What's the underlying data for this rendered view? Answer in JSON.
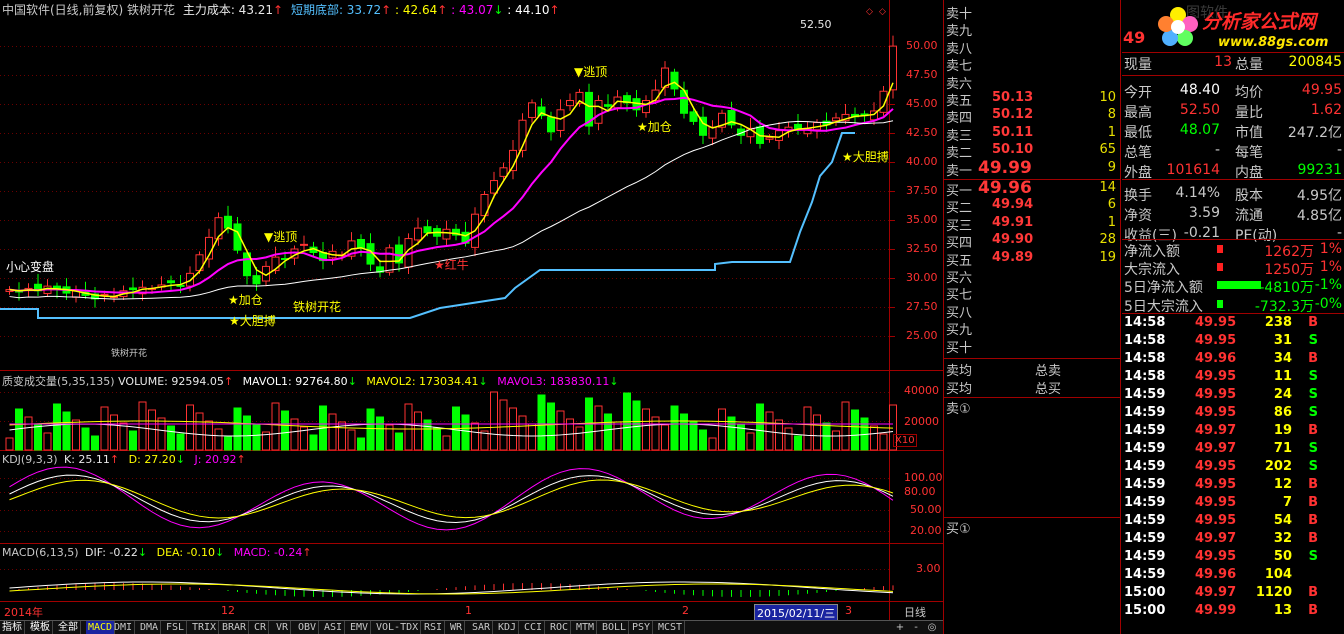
{
  "header": {
    "title": "中国软件(日线,前复权) 铁树开花",
    "cost_label": "主力成本: 43.21",
    "short_bottom_label": "短期底部: 33.72",
    "v2": ": 42.64",
    "v3": ": 43.07",
    "v4": ": 44.10"
  },
  "price_axis": [
    "50.00",
    "47.50",
    "45.00",
    "42.50",
    "40.00",
    "37.50",
    "35.00",
    "32.50",
    "30.00",
    "27.50",
    "25.00"
  ],
  "price_notes": {
    "high_marker": "52.50",
    "warn": "小心变盘",
    "escape_top_1": "▼逃顶",
    "escape_top_2": "▼逃顶",
    "add_1": "★加仓",
    "add_2": "★加仓",
    "bold_1": "★大胆搏",
    "bold_2": "★大胆搏",
    "tree_1": "铁树开花",
    "tree_2": "铁树开花",
    "red_star": "★红牛"
  },
  "volume": {
    "label": "质变成交量(5,35,135)",
    "volume": "VOLUME: 92594.05",
    "mavol1": "MAVOL1: 92764.80",
    "mavol2": "MAVOL2: 173034.41",
    "mavol3": "MAVOL3: 183830.11",
    "axis": [
      "40000",
      "20000"
    ],
    "unit": "X10"
  },
  "kdj": {
    "label": "KDJ(9,3,3)",
    "k": "K: 25.11",
    "d": "D: 27.20",
    "j": "J: 20.92",
    "axis": [
      "100.00",
      "80.00",
      "50.00",
      "20.00"
    ]
  },
  "macd": {
    "label": "MACD(6,13,5)",
    "dif": "DIF: -0.22",
    "dea": "DEA: -0.10",
    "macd": "MACD: -0.24",
    "axis": [
      "3.00"
    ]
  },
  "date_axis": {
    "labels": [
      "2014年",
      "12",
      "1",
      "2",
      "3"
    ],
    "cursor_date": "2015/02/11/三",
    "period": "日线"
  },
  "bottom_tabs": [
    "指标",
    "模板",
    "全部",
    "MACD",
    "DMI",
    "DMA",
    "FSL",
    "TRIX",
    "BRAR",
    "CR",
    "VR",
    "OBV",
    "ASI",
    "EMV",
    "VOL-TDX",
    "RSI",
    "WR",
    "SAR",
    "KDJ",
    "CCI",
    "ROC",
    "MTM",
    "BOLL",
    "PSY",
    "MCST"
  ],
  "bottom_ctrl": [
    "+",
    "-",
    "◎"
  ],
  "order_book": {
    "sells": [
      {
        "label": "卖十",
        "price": "",
        "vol": ""
      },
      {
        "label": "卖九",
        "price": "",
        "vol": ""
      },
      {
        "label": "卖八",
        "price": "",
        "vol": ""
      },
      {
        "label": "卖七",
        "price": "",
        "vol": ""
      },
      {
        "label": "卖六",
        "price": "",
        "vol": ""
      },
      {
        "label": "卖五",
        "price": "50.13",
        "vol": "10"
      },
      {
        "label": "卖四",
        "price": "50.12",
        "vol": "8"
      },
      {
        "label": "卖三",
        "price": "50.11",
        "vol": "1"
      },
      {
        "label": "卖二",
        "price": "50.10",
        "vol": "65"
      },
      {
        "label": "卖一",
        "price": "49.99",
        "vol": "9"
      }
    ],
    "buys": [
      {
        "label": "买一",
        "price": "49.96",
        "vol": "14"
      },
      {
        "label": "买二",
        "price": "49.94",
        "vol": "6"
      },
      {
        "label": "买三",
        "price": "49.91",
        "vol": "1"
      },
      {
        "label": "买四",
        "price": "49.90",
        "vol": "28"
      },
      {
        "label": "买五",
        "price": "49.89",
        "vol": "19"
      },
      {
        "label": "买六",
        "price": "",
        "vol": ""
      },
      {
        "label": "买七",
        "price": "",
        "vol": ""
      },
      {
        "label": "买八",
        "price": "",
        "vol": ""
      },
      {
        "label": "买九",
        "price": "",
        "vol": ""
      },
      {
        "label": "买十",
        "price": "",
        "vol": ""
      }
    ],
    "avg_sell": "卖均",
    "avg_buy": "买均",
    "total_sell": "总卖",
    "total_buy": "总买",
    "sell1_queue": "卖①",
    "buy1_queue": "买①"
  },
  "quote": {
    "logo_text": "分析家公式网",
    "logo_url": "www.88gs.com",
    "code_partial": "49",
    "faint_text": "图软件",
    "xianliang": "现量",
    "xianliang_v": "13",
    "zongliang": "总量",
    "zongliang_v": "200845",
    "rows": [
      [
        "今开",
        "48.40",
        "均价",
        "49.95"
      ],
      [
        "最高",
        "52.50",
        "量比",
        "1.62"
      ],
      [
        "最低",
        "48.07",
        "市值",
        "247.2亿"
      ],
      [
        "总笔",
        "-",
        "每笔",
        "-"
      ],
      [
        "外盘",
        "101614",
        "内盘",
        "99231"
      ],
      [
        "换手",
        "4.14%",
        "股本",
        "4.95亿"
      ],
      [
        "净资",
        "3.59",
        "流通",
        "4.85亿"
      ],
      [
        "收益(三)",
        "-0.21",
        "PE(动)",
        "-"
      ]
    ],
    "flows": [
      [
        "净流入额",
        "1262万",
        "1%"
      ],
      [
        "大宗流入",
        "1250万",
        "1%"
      ],
      [
        "5日净流入额",
        "-4810万",
        "-1%"
      ],
      [
        "5日大宗流入",
        "-732.3万",
        "-0%"
      ]
    ]
  },
  "ticks": [
    [
      "14:58",
      "49.95",
      "238",
      "B"
    ],
    [
      "14:58",
      "49.95",
      "31",
      "S"
    ],
    [
      "14:58",
      "49.96",
      "34",
      "B"
    ],
    [
      "14:58",
      "49.95",
      "11",
      "S"
    ],
    [
      "14:59",
      "49.95",
      "24",
      "S"
    ],
    [
      "14:59",
      "49.95",
      "86",
      "S"
    ],
    [
      "14:59",
      "49.97",
      "19",
      "B"
    ],
    [
      "14:59",
      "49.97",
      "71",
      "S"
    ],
    [
      "14:59",
      "49.95",
      "202",
      "S"
    ],
    [
      "14:59",
      "49.95",
      "12",
      "B"
    ],
    [
      "14:59",
      "49.95",
      "7",
      "B"
    ],
    [
      "14:59",
      "49.95",
      "54",
      "B"
    ],
    [
      "14:59",
      "49.97",
      "32",
      "B"
    ],
    [
      "14:59",
      "49.95",
      "50",
      "S"
    ],
    [
      "14:59",
      "49.96",
      "104",
      ""
    ],
    [
      "15:00",
      "49.97",
      "1120",
      "B"
    ],
    [
      "15:00",
      "49.99",
      "13",
      "B"
    ]
  ],
  "colors": {
    "up": "#ff3232",
    "down": "#00ff00",
    "yellow": "#ffff00",
    "magenta": "#ff00ff",
    "white": "#ffffff",
    "cyan": "#54c0ff",
    "panel_border": "#a00000"
  }
}
